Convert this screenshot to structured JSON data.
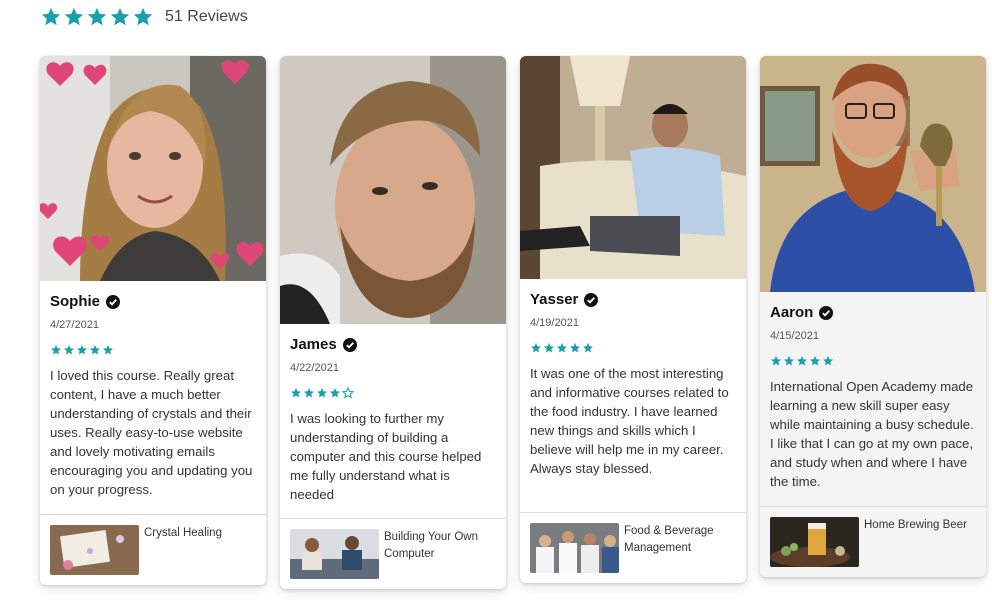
{
  "summary": {
    "rating": 5,
    "reviews_label": "51 Reviews",
    "star_color": "#1aa0ad"
  },
  "reviews": [
    {
      "name": "Sophie",
      "date": "4/27/2021",
      "stars": 5,
      "text": "I loved this course. Really great content, I have a much better understanding of crystals and their uses. Really easy-to-use website and lovely motivating emails encouraging you and updating you on your progress.",
      "course": "Crystal Healing"
    },
    {
      "name": "James",
      "date": "4/22/2021",
      "stars": 4,
      "text": "I was looking to further my understanding of building a computer and this course helped me fully understand what is needed",
      "course": "Building Your Own Computer"
    },
    {
      "name": "Yasser",
      "date": "4/19/2021",
      "stars": 5,
      "text": "It was one of the most interesting and informative courses related to the food industry. I have learned new things and skills which I believe will help me in my career. Always stay blessed.",
      "course": "Food & Beverage Management"
    },
    {
      "name": "Aaron",
      "date": "4/15/2021",
      "stars": 5,
      "text": "International Open Academy made learning a new skill super easy while maintaining a busy schedule. I like that I can go at my own pace, and study when and where I have the time.",
      "course": "Home Brewing Beer"
    }
  ]
}
